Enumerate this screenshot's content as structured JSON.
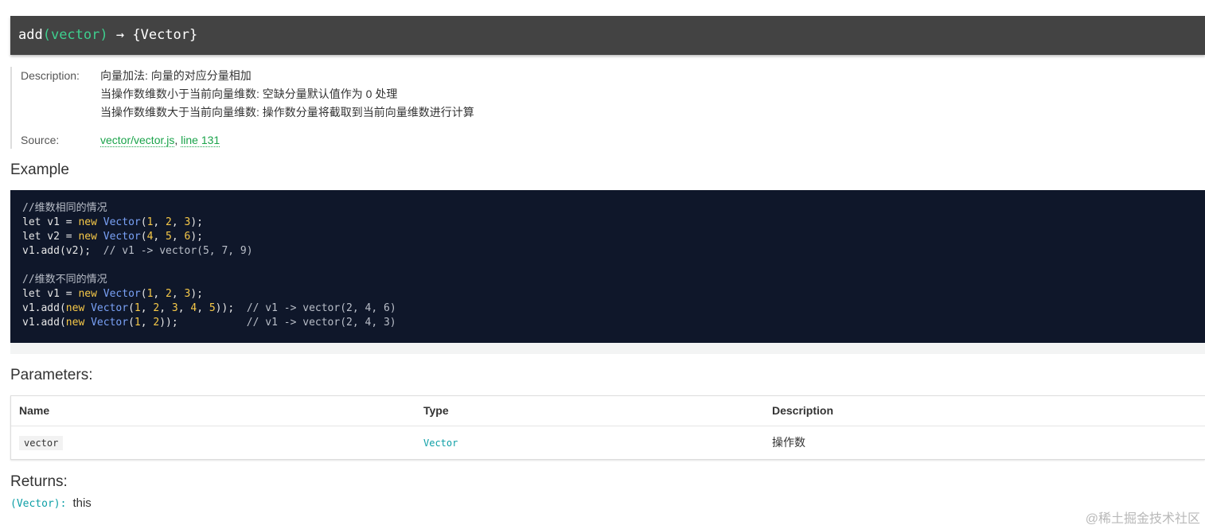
{
  "signature": {
    "name": "add",
    "params": "(vector)",
    "arrow": "→",
    "returns": "{Vector}"
  },
  "details": {
    "description_label": "Description:",
    "description_lines": [
      "向量加法: 向量的对应分量相加",
      "当操作数维数小于当前向量维数: 空缺分量默认值作为 0 处理",
      "当操作数维数大于当前向量维数: 操作数分量将截取到当前向量维数进行计算"
    ],
    "source_label": "Source:",
    "source_file": "vector/vector.js",
    "source_sep": ",",
    "source_line": "line 131"
  },
  "example": {
    "heading": "Example",
    "lines": [
      "//维数相同的情况",
      "let v1 = new Vector(1, 2, 3);",
      "let v2 = new Vector(4, 5, 6);",
      "v1.add(v2);  // v1 -> vector(5, 7, 9)",
      "",
      "//维数不同的情况",
      "let v1 = new Vector(1, 2, 3);",
      "v1.add(new Vector(1, 2, 3, 4, 5));  // v1 -> vector(2, 4, 6)",
      "v1.add(new Vector(1, 2));           // v1 -> vector(2, 4, 3)"
    ]
  },
  "parameters": {
    "heading": "Parameters:",
    "columns": [
      "Name",
      "Type",
      "Description"
    ],
    "rows": [
      {
        "name": "vector",
        "type": "Vector",
        "description": "操作数"
      }
    ]
  },
  "returns": {
    "heading": "Returns:",
    "type": "(Vector):",
    "text": "this"
  },
  "watermark": "@稀土掘金技术社区"
}
